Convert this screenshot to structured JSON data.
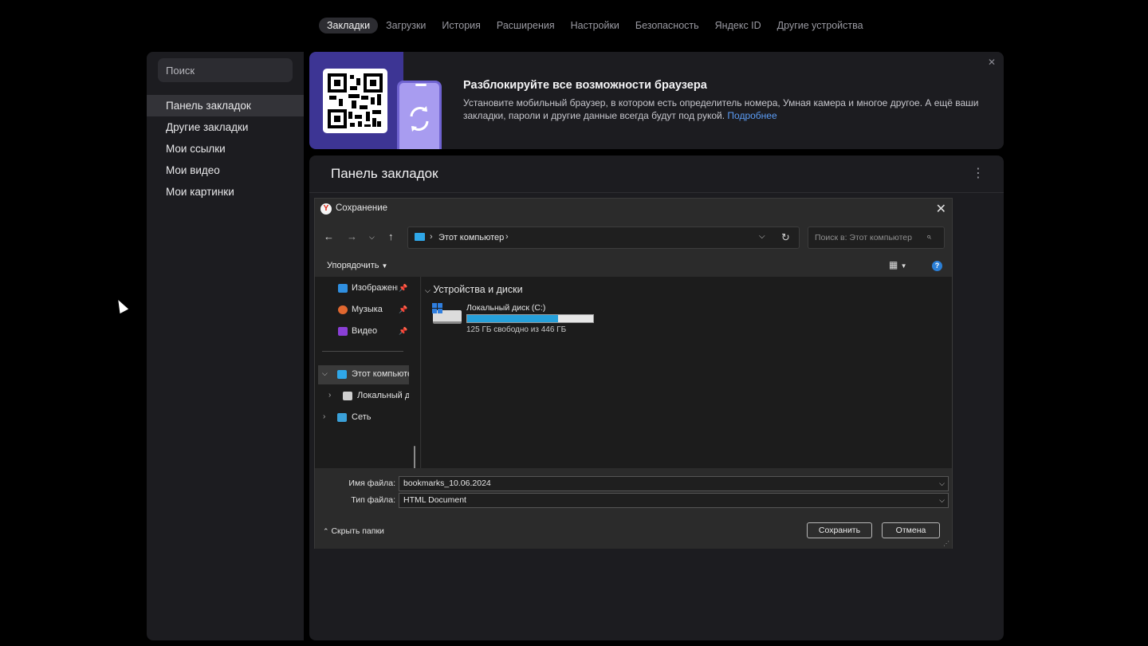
{
  "topnav": {
    "tabs": [
      {
        "label": "Закладки",
        "active": true
      },
      {
        "label": "Загрузки",
        "active": false
      },
      {
        "label": "История",
        "active": false
      },
      {
        "label": "Расширения",
        "active": false
      },
      {
        "label": "Настройки",
        "active": false
      },
      {
        "label": "Безопасность",
        "active": false
      },
      {
        "label": "Яндекс ID",
        "active": false
      },
      {
        "label": "Другие устройства",
        "active": false
      }
    ]
  },
  "sidebar": {
    "search_placeholder": "Поиск",
    "items": [
      {
        "label": "Панель закладок",
        "active": true
      },
      {
        "label": "Другие закладки",
        "active": false
      },
      {
        "label": "Мои ссылки",
        "active": false
      },
      {
        "label": "Мои видео",
        "active": false
      },
      {
        "label": "Мои картинки",
        "active": false
      }
    ]
  },
  "promo": {
    "title": "Разблокируйте все возможности браузера",
    "description": "Установите мобильный браузер, в котором есть определитель номера, Умная камера и многое другое. А ещё ваши закладки, пароли и другие данные всегда будут под рукой.",
    "link": "Подробнее",
    "accent_color": "#3d3594"
  },
  "panel": {
    "title": "Панель закладок"
  },
  "dialog": {
    "title": "Сохранение",
    "address": "Этот компьютер",
    "search_placeholder": "Поиск в: Этот компьютер",
    "organize": "Упорядочить",
    "nav": {
      "quick": [
        {
          "label": "Изображени",
          "icon": "pictures-icon"
        },
        {
          "label": "Музыка",
          "icon": "music-icon"
        },
        {
          "label": "Видео",
          "icon": "video-icon"
        }
      ],
      "this_pc": "Этот компьюте",
      "local_disk": "Локальный ди",
      "network": "Сеть"
    },
    "group_title": "Устройства и диски",
    "drive": {
      "name": "Локальный диск (C:)",
      "free_text": "125 ГБ свободно из 446 ГБ",
      "used_fraction": 0.72
    },
    "filename_label": "Имя файла:",
    "filename": "bookmarks_10.06.2024",
    "filetype_label": "Тип файла:",
    "filetype": "HTML Document",
    "hide_folders": "Скрыть папки",
    "save": "Сохранить",
    "cancel": "Отмена"
  }
}
